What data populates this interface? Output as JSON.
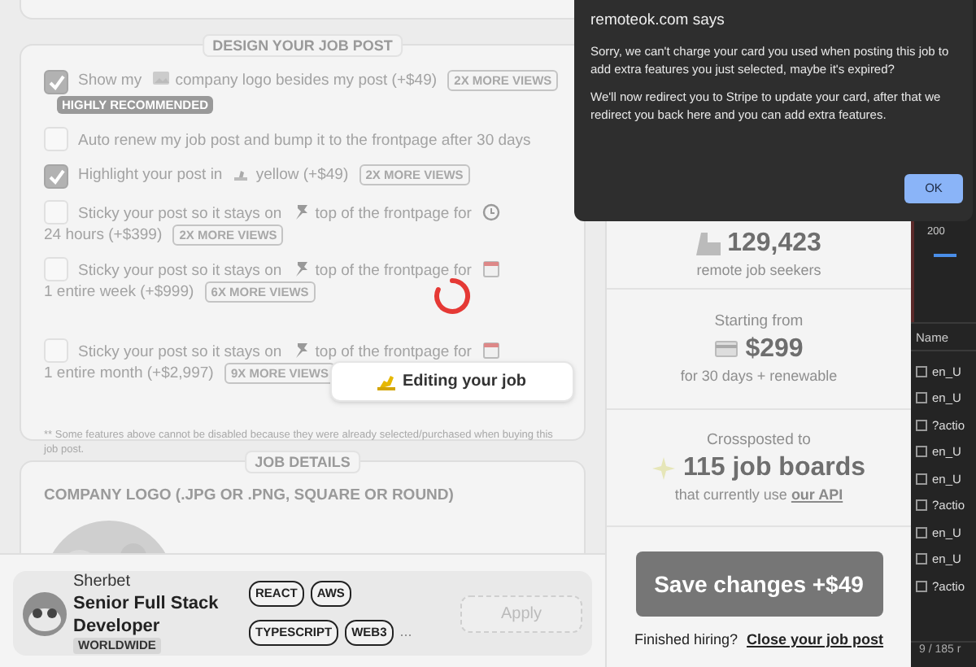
{
  "design": {
    "legend": "DESIGN YOUR JOB POST",
    "options": [
      {
        "segments": [
          "Show my",
          "company logo besides my post (+$49)"
        ],
        "checked": true,
        "badge": "2X MORE VIEWS",
        "tag": "HIGHLY RECOMMENDED"
      },
      {
        "segments": [
          "Auto renew my job post and bump it to the frontpage after 30 days"
        ],
        "checked": false
      },
      {
        "segments": [
          "Highlight your post in",
          "yellow (+$49)"
        ],
        "checked": true,
        "badge": "2X MORE VIEWS"
      },
      {
        "segments": [
          "Sticky your post so it stays on",
          "top of the frontpage for",
          "24 hours (+$399)"
        ],
        "checked": false,
        "badge": "2X MORE VIEWS"
      },
      {
        "segments": [
          "Sticky your post so it stays on",
          "top of the frontpage for",
          "1 entire week (+$999)"
        ],
        "checked": false,
        "badge": "6X MORE VIEWS"
      },
      {
        "segments": [
          "Sticky your post so it stays on",
          "top of the frontpage for",
          "1 entire month (+$2,997)"
        ],
        "checked": false,
        "badge": "9X MORE VIEWS"
      }
    ],
    "footnote": "** Some features above cannot be disabled because they were already selected/purchased when buying this job post."
  },
  "toast": "Editing your job",
  "job_details": {
    "legend": "JOB DETAILS",
    "logo_label": "COMPANY LOGO (.JPG OR .PNG, SQUARE OR ROUND)"
  },
  "preview": {
    "company": "Sherbet",
    "title": "Senior Full Stack Developer",
    "location": "WORLDWIDE",
    "tags": [
      "REACT",
      "AWS",
      "TYPESCRIPT",
      "WEB3"
    ],
    "more": "...",
    "apply": "Apply"
  },
  "stats": [
    {
      "kind": "seekers",
      "value": "129,423",
      "caption": "remote job seekers"
    },
    {
      "kind": "price",
      "label": "Starting from",
      "value": "$299",
      "caption": "for 30 days + renewable"
    },
    {
      "kind": "boards",
      "label": "Crossposted to",
      "value": "115 job boards",
      "caption": "that currently use",
      "link": "our API"
    }
  ],
  "save_button": "Save changes +$49",
  "finished": {
    "text": "Finished hiring?",
    "link": "Close your job post"
  },
  "devtools": {
    "timeline_label": "200",
    "column": "Name",
    "rows": [
      {
        "name": "en_U",
        "checked": false
      },
      {
        "name": "en_U",
        "checked": false
      },
      {
        "name": "?actio",
        "checked": false
      },
      {
        "name": "en_U",
        "checked": false
      },
      {
        "name": "en_U",
        "checked": false
      },
      {
        "name": "?actio",
        "checked": false
      },
      {
        "name": "en_U",
        "checked": false
      },
      {
        "name": "en_U",
        "checked": false
      },
      {
        "name": "?actio",
        "checked": false
      }
    ],
    "status": "9 / 185 r"
  },
  "dialog": {
    "title": "remoteok.com says",
    "paragraphs": [
      "Sorry, we can't charge your card you used when posting this job to add extra features you just selected, maybe it's expired?",
      "We'll now redirect you to Stripe to update your card, after that we redirect you back here and you can add extra features."
    ],
    "ok": "OK"
  }
}
